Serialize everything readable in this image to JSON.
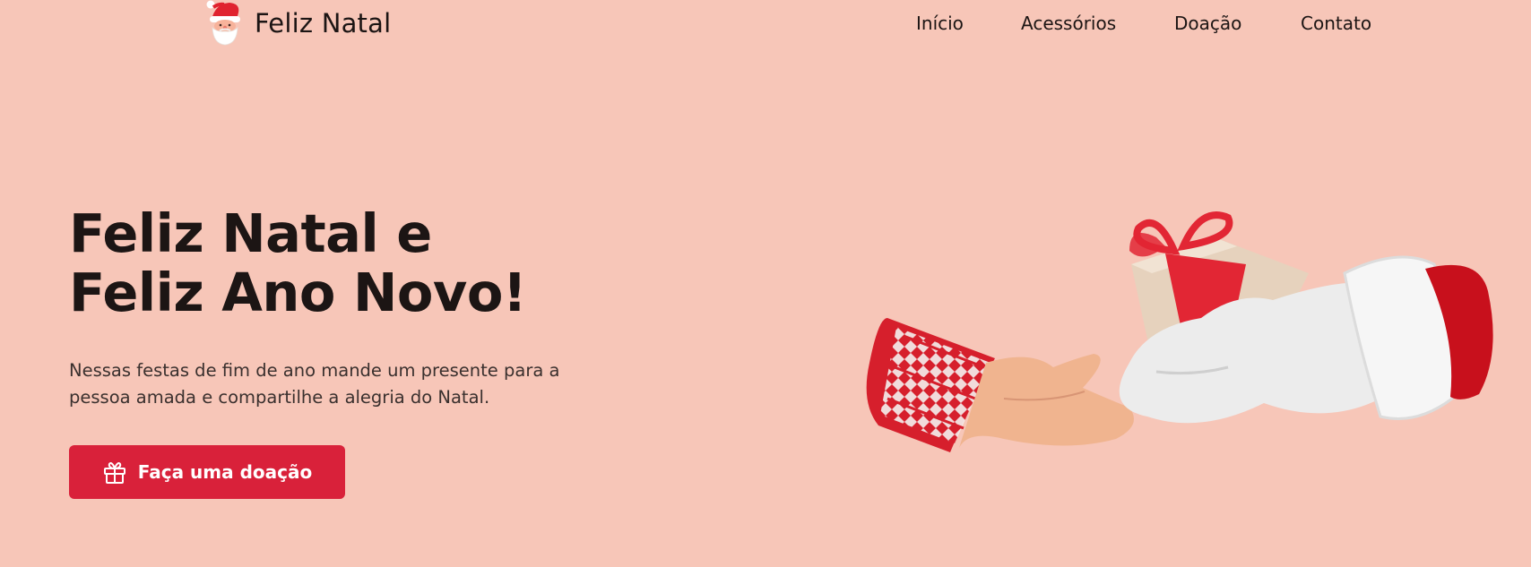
{
  "brand": {
    "name": "Feliz Natal",
    "icon": "santa-claus-icon"
  },
  "nav": {
    "items": [
      "Início",
      "Acessórios",
      "Doação",
      "Contato"
    ]
  },
  "hero": {
    "title_line1": "Feliz Natal e",
    "title_line2": "Feliz Ano Novo!",
    "description": "Nessas festas de fim de ano mande um presente para a pessoa amada e compartilhe a alegria do Natal.",
    "cta_label": "Faça uma doação",
    "cta_icon": "gift-icon"
  },
  "colors": {
    "background": "#f7c6b8",
    "accent": "#d9213a",
    "text": "#1c1514"
  }
}
